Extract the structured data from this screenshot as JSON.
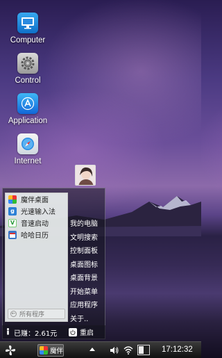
{
  "desktop": {
    "icons": [
      {
        "label": "Computer",
        "icon": "computer-icon"
      },
      {
        "label": "Control",
        "icon": "gear-icon"
      },
      {
        "label": "Application",
        "icon": "appstore-icon"
      },
      {
        "label": "Internet",
        "icon": "compass-icon"
      }
    ]
  },
  "start_menu": {
    "apps": [
      {
        "label": "魔伴桌面",
        "icon": "pinwheel-icon"
      },
      {
        "label": "光速输入法",
        "icon": "g-icon"
      },
      {
        "label": "音速启动",
        "icon": "v-icon"
      },
      {
        "label": "哈哈日历",
        "icon": "calendar-icon"
      }
    ],
    "all_programs_label": "所有程序",
    "shortcuts": [
      "我的电脑",
      "文明搜索",
      "控制面板",
      "桌面图标",
      "桌面背景",
      "开始菜单",
      "应用程序",
      "关于.."
    ],
    "earnings_label": "已赚：2.61元",
    "restart_label": "重启"
  },
  "taskbar": {
    "task_label": "魔伴",
    "clock": "17:12:32"
  }
}
